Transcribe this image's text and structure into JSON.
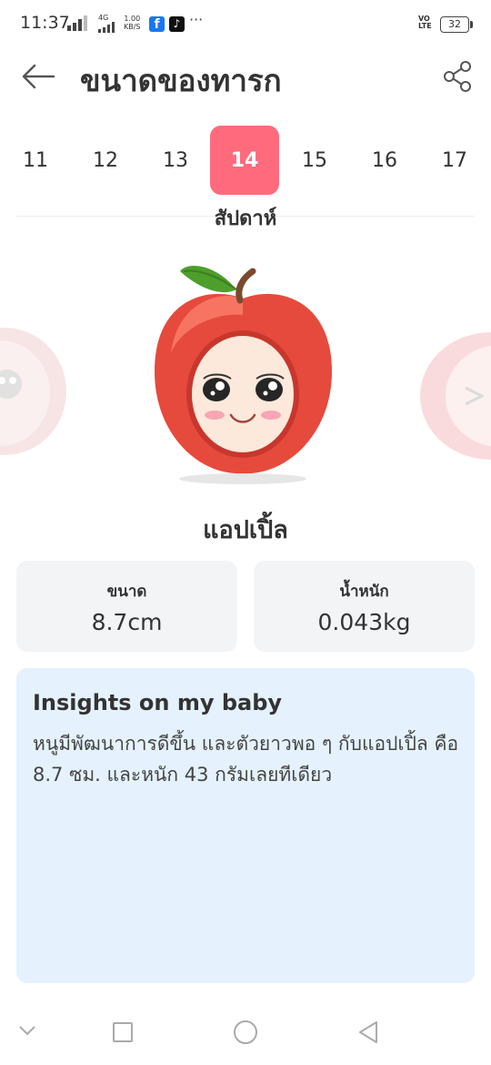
{
  "status_bar": {
    "time": "11:37",
    "network": "4G",
    "speed_value": "1.00",
    "speed_unit": "KB/S",
    "more": "···",
    "volte": "VO LTE",
    "battery": "32",
    "app_icons": [
      "facebook-icon",
      "tiktok-icon"
    ]
  },
  "header": {
    "title": "ขนาดของทารก",
    "back_icon": "arrow-left-icon",
    "share_icon": "share-icon"
  },
  "weeks": {
    "items": [
      "11",
      "12",
      "13",
      "14",
      "15",
      "16",
      "17"
    ],
    "selected": "14",
    "unit_label": "สัปดาห์"
  },
  "fruit": {
    "name": "แอปเปิ้ล",
    "main_icon": "apple-character-icon",
    "prev_icon": "onion-character-icon",
    "next_icon": "peach-character-icon"
  },
  "stats": {
    "size_label": "ขนาด",
    "size_value": "8.7cm",
    "weight_label": "น้ำหนัก",
    "weight_value": "0.043kg"
  },
  "insights": {
    "title": "Insights on my baby",
    "body": "หนูมีพัฒนาการดีขึ้น และตัวยาวพอ ๆ กับแอปเปิ้ล คือ 8.7 ซม. และหนัก 43 กรัมเลยทีเดียว"
  },
  "colors": {
    "accent": "#ff6b7d",
    "card_bg": "#f3f4f6",
    "insights_bg": "#e5f2fd",
    "text": "#333333"
  },
  "navbar": {
    "icons": [
      "chevron-down-icon",
      "recents-square-icon",
      "home-circle-icon",
      "back-triangle-icon"
    ]
  }
}
